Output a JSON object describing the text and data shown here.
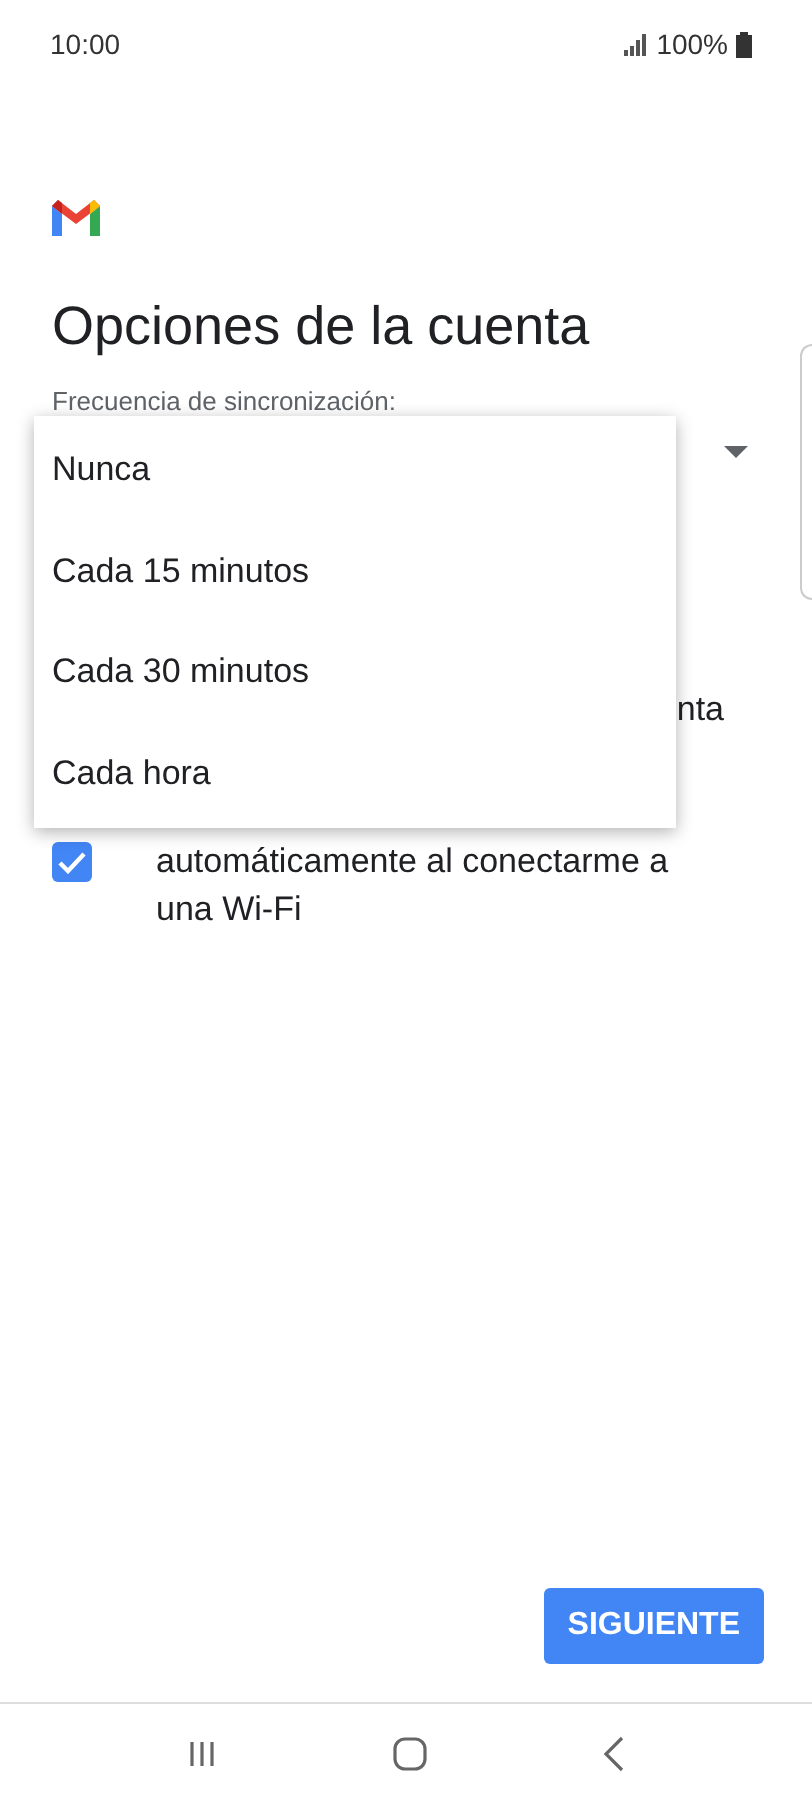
{
  "status_bar": {
    "time": "10:00",
    "battery": "100%"
  },
  "title": "Opciones de la cuenta",
  "sync_field": {
    "label": "Frecuencia de sincronización:"
  },
  "partial_text": "nta",
  "checkbox_row": {
    "checked": true,
    "label": "automáticamente al conectarme a una Wi-Fi"
  },
  "dropdown_menu": {
    "items": [
      {
        "label": "Nunca"
      },
      {
        "label": "Cada 15 minutos"
      },
      {
        "label": "Cada 30 minutos"
      },
      {
        "label": "Cada hora"
      }
    ]
  },
  "next_button": "SIGUIENTE"
}
